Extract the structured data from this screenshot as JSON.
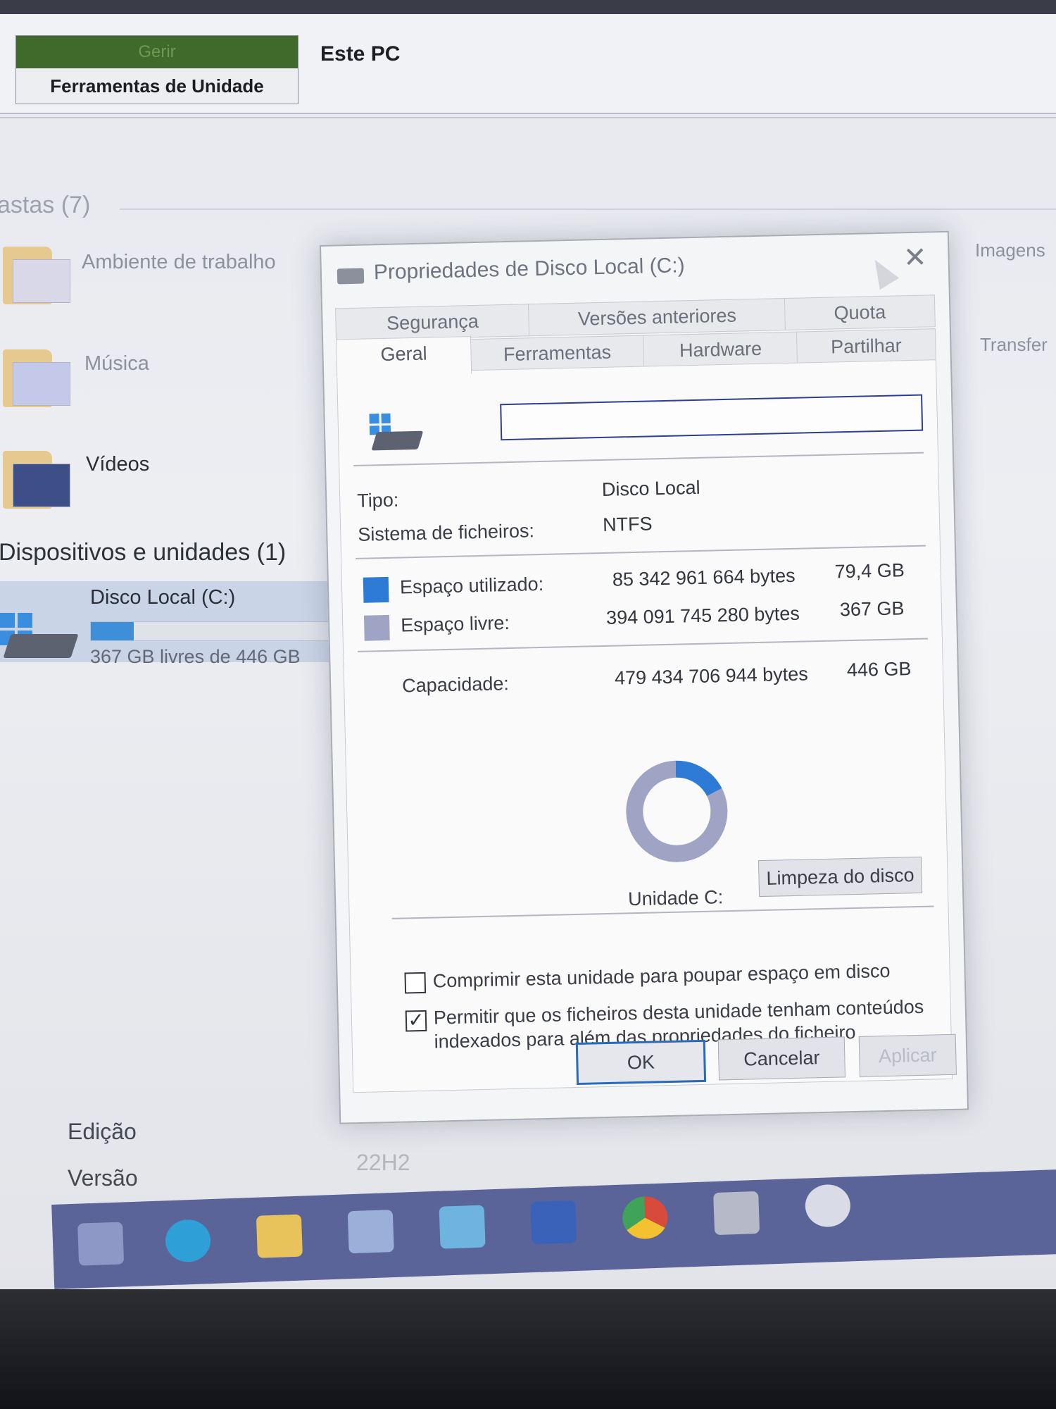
{
  "explorer": {
    "ribbon": {
      "context_tab": "Gerir",
      "context_group": "Ferramentas de Unidade",
      "location": "Este PC"
    },
    "folders_section": "astas (7)",
    "folders": [
      {
        "label": "Ambiente de trabalho",
        "icon": "desktop-folder-icon"
      },
      {
        "label": "Música",
        "icon": "music-folder-icon"
      },
      {
        "label": "Vídeos",
        "icon": "videos-folder-icon"
      }
    ],
    "right_folders": [
      "Imagens",
      "Transfer"
    ],
    "devices_section": "Dispositivos e unidades (1)",
    "drive": {
      "name": "Disco Local (C:)",
      "free_text": "367 GB livres de 446 GB",
      "used_fraction": 0.18
    },
    "about": {
      "edition_label": "Edição",
      "version_label": "Versão",
      "version_value": "22H2"
    }
  },
  "dialog": {
    "title": "Propriedades de Disco Local (C:)",
    "close": "✕",
    "tabs_back": [
      "Segurança",
      "Versões anteriores",
      "Quota"
    ],
    "tabs_front": [
      "Geral",
      "Ferramentas",
      "Hardware",
      "Partilhar"
    ],
    "active_tab": "Geral",
    "name_value": "",
    "type_label": "Tipo:",
    "type_value": "Disco Local",
    "fs_label": "Sistema de ficheiros:",
    "fs_value": "NTFS",
    "used_label": "Espaço utilizado:",
    "used_bytes": "85 342 961 664 bytes",
    "used_gb": "79,4 GB",
    "free_label": "Espaço livre:",
    "free_bytes": "394 091 745 280 bytes",
    "free_gb": "367 GB",
    "capacity_label": "Capacidade:",
    "capacity_bytes": "479 434 706 944 bytes",
    "capacity_gb": "446 GB",
    "drive_label": "Unidade C:",
    "cleanup_button": "Limpeza do disco",
    "compress_label": "Comprimir esta unidade para poupar espaço em disco",
    "compress_checked": false,
    "index_label_line1": "Permitir que os ficheiros desta unidade tenham conteúdos",
    "index_label_line2": "indexados para além das propriedades do ficheiro",
    "index_checked": true,
    "ok": "OK",
    "cancel": "Cancelar",
    "apply": "Aplicar",
    "colors": {
      "used": "#2e7bd6",
      "free": "#9fa3c4"
    },
    "used_fraction": 0.178
  },
  "taskbar": {
    "icons": [
      "task-view-icon",
      "edge-icon",
      "file-explorer-icon",
      "store-icon",
      "mail-icon",
      "remote-icon",
      "chrome-icon",
      "printer-icon",
      "settings-icon"
    ]
  }
}
